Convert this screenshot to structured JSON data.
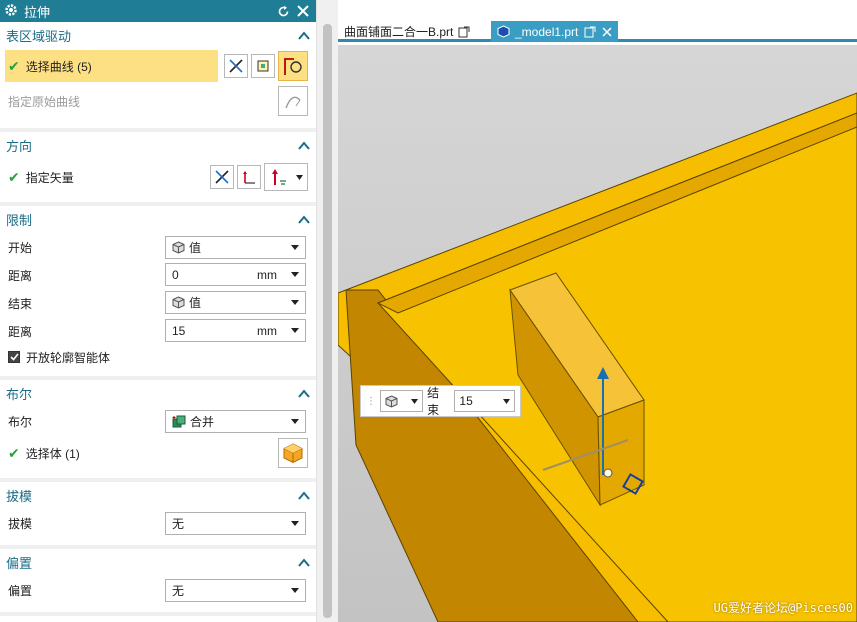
{
  "dialog": {
    "title": "拉伸",
    "sections": {
      "section1": {
        "title": "表区域驱动",
        "select_curve_label": "选择曲线 (5)",
        "specify_origin_curve": "指定原始曲线"
      },
      "direction": {
        "title": "方向",
        "specify_vector": "指定矢量"
      },
      "limits": {
        "title": "限制",
        "start_label": "开始",
        "start_value": "值",
        "start_distance_label": "距离",
        "start_distance": "0",
        "start_unit": "mm",
        "end_label": "结束",
        "end_value": "值",
        "end_distance_label": "距离",
        "end_distance": "15",
        "end_unit": "mm",
        "open_profile": "开放轮廓智能体"
      },
      "boolean": {
        "title": "布尔",
        "bool_label": "布尔",
        "bool_value": "合并",
        "select_body": "选择体 (1)"
      },
      "draft": {
        "title": "拔模",
        "label": "拔模",
        "value": "无"
      },
      "offset": {
        "title": "偏置",
        "label": "偏置",
        "value": "无"
      }
    }
  },
  "tabs": {
    "tab1": "曲面铺面二合一B.prt",
    "tab2": "_model1.prt"
  },
  "handle": {
    "end_label": "结束",
    "end_value": "15"
  },
  "watermark": "UG爱好者论坛@Pisces00",
  "colors": {
    "accent": "#1f7d96",
    "highlight": "#fde083",
    "part": "#f5b800",
    "check": "#27a33a"
  }
}
